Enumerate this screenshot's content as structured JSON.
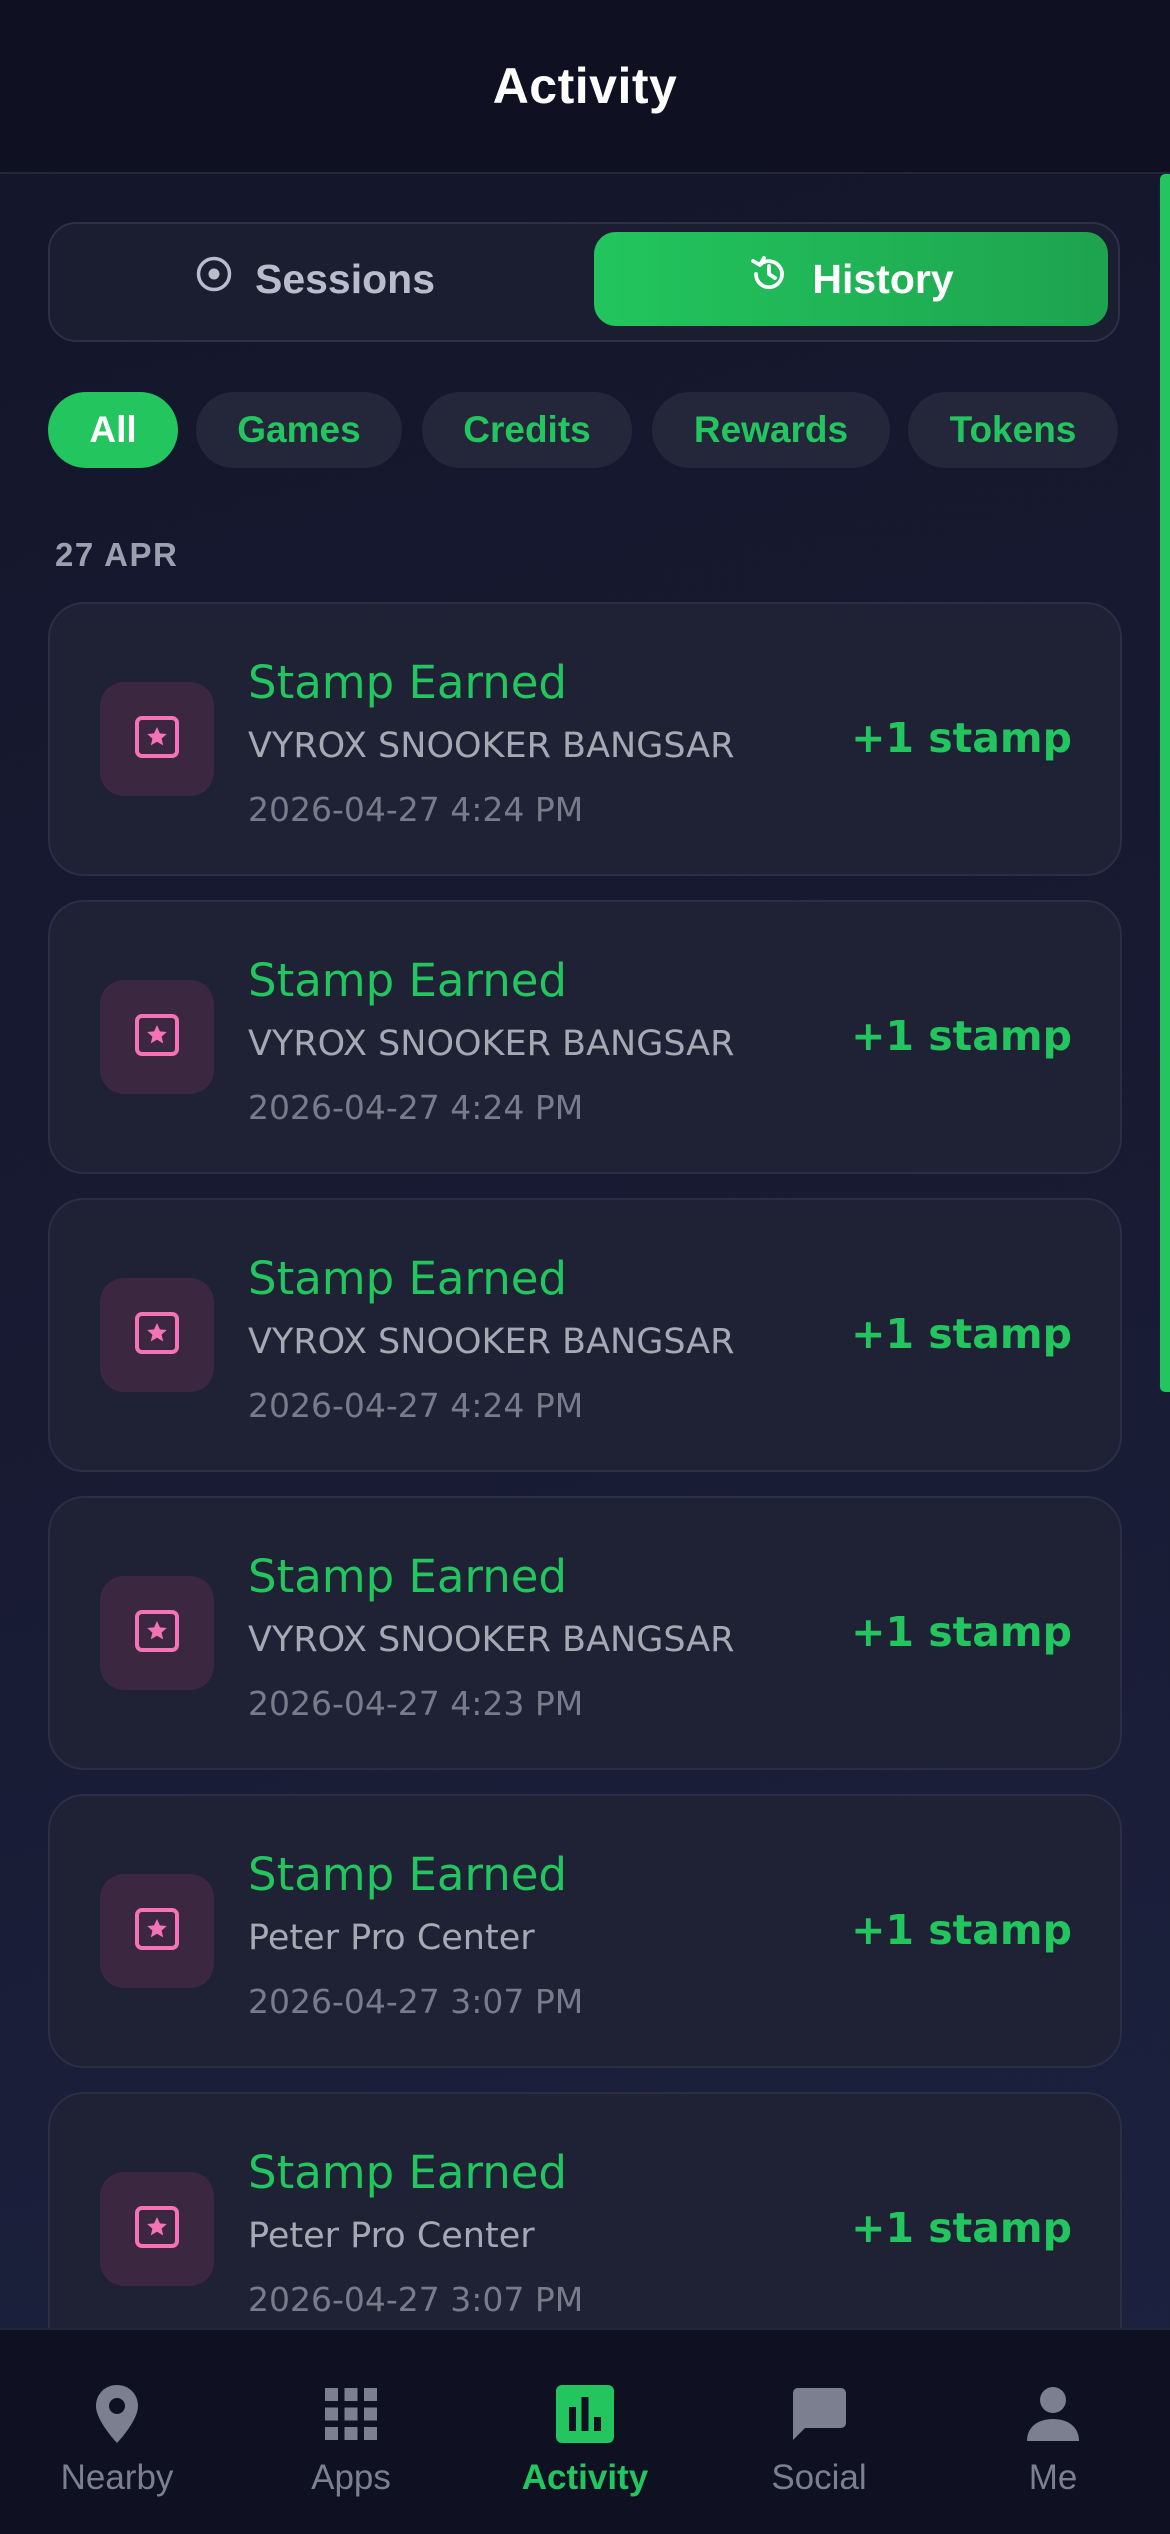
{
  "header": {
    "title": "Activity"
  },
  "segment": {
    "sessions_label": "Sessions",
    "history_label": "History",
    "active": "history"
  },
  "filters": [
    {
      "label": "All",
      "active": true
    },
    {
      "label": "Games",
      "active": false
    },
    {
      "label": "Credits",
      "active": false
    },
    {
      "label": "Rewards",
      "active": false
    },
    {
      "label": "Tokens",
      "active": false
    }
  ],
  "group": {
    "date_label": "27 APR"
  },
  "items": [
    {
      "title": "Stamp Earned",
      "venue": "VYROX SNOOKER BANGSAR",
      "time": "2026-04-27 4:24 PM",
      "amount": "+1 stamp",
      "icon": "star-photo-icon"
    },
    {
      "title": "Stamp Earned",
      "venue": "VYROX SNOOKER BANGSAR",
      "time": "2026-04-27 4:24 PM",
      "amount": "+1 stamp",
      "icon": "star-photo-icon"
    },
    {
      "title": "Stamp Earned",
      "venue": "VYROX SNOOKER BANGSAR",
      "time": "2026-04-27 4:24 PM",
      "amount": "+1 stamp",
      "icon": "star-photo-icon"
    },
    {
      "title": "Stamp Earned",
      "venue": "VYROX SNOOKER BANGSAR",
      "time": "2026-04-27 4:23 PM",
      "amount": "+1 stamp",
      "icon": "star-photo-icon"
    },
    {
      "title": "Stamp Earned",
      "venue": "Peter Pro Center",
      "time": "2026-04-27 3:07 PM",
      "amount": "+1 stamp",
      "icon": "star-photo-icon"
    },
    {
      "title": "Stamp Earned",
      "venue": "Peter Pro Center",
      "time": "2026-04-27 3:07 PM",
      "amount": "+1 stamp",
      "icon": "star-photo-icon"
    }
  ],
  "nav": [
    {
      "label": "Nearby",
      "icon": "location-pin-icon",
      "active": false
    },
    {
      "label": "Apps",
      "icon": "apps-grid-icon",
      "active": false
    },
    {
      "label": "Activity",
      "icon": "bar-chart-icon",
      "active": true
    },
    {
      "label": "Social",
      "icon": "chat-bubble-icon",
      "active": false
    },
    {
      "label": "Me",
      "icon": "person-icon",
      "active": false
    }
  ],
  "colors": {
    "accent": "#22c55e",
    "stamp_icon": "#f472b6",
    "background": "#13162a"
  }
}
